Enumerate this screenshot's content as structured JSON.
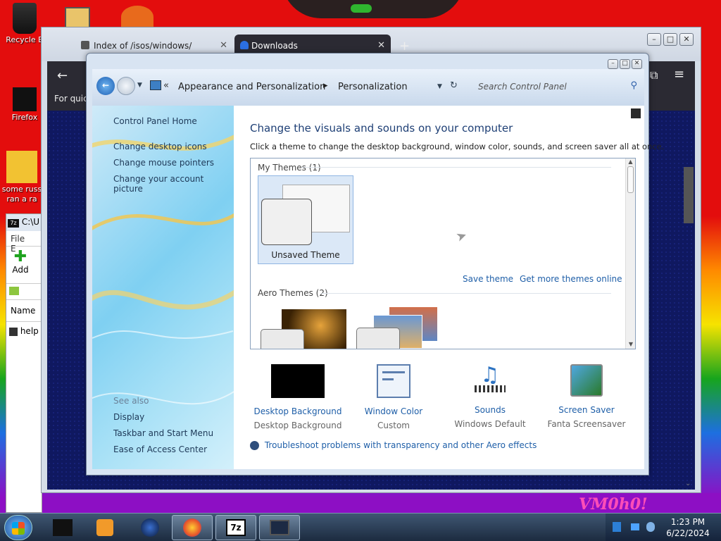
{
  "desktop": {
    "icons": [
      {
        "name": "recycle-bin",
        "label": "Recycle B"
      },
      {
        "name": "firefox",
        "label": "Firefox"
      },
      {
        "name": "some-russian-file",
        "label": "some russ\nran a ra"
      }
    ],
    "vm_label": "VM0h0!"
  },
  "browser": {
    "tabs": [
      {
        "label": "Index of /isos/windows/"
      },
      {
        "label": "Downloads"
      }
    ],
    "toolbar_text": "For quick"
  },
  "sevenzip": {
    "title": "C:\\U",
    "menu": [
      "File",
      "E"
    ],
    "add_label": "Add",
    "column_name": "Name",
    "file": "help"
  },
  "control_panel": {
    "breadcrumb": [
      "Appearance and Personalization",
      "Personalization"
    ],
    "search_placeholder": "Search Control Panel",
    "left_links": [
      "Control Panel Home",
      "Change desktop icons",
      "Change mouse pointers",
      "Change your account picture"
    ],
    "see_also_heading": "See also",
    "see_also_links": [
      "Display",
      "Taskbar and Start Menu",
      "Ease of Access Center"
    ],
    "heading": "Change the visuals and sounds on your computer",
    "description": "Click a theme to change the desktop background, window color, sounds, and screen saver all at once.",
    "my_themes_heading": "My Themes (1)",
    "unsaved_theme_label": "Unsaved Theme",
    "save_theme": "Save theme",
    "get_more_themes": "Get more themes online",
    "aero_themes_heading": "Aero Themes (2)",
    "bottom_items": [
      {
        "label": "Desktop Background",
        "sub": "Desktop Background"
      },
      {
        "label": "Window Color",
        "sub": "Custom"
      },
      {
        "label": "Sounds",
        "sub": "Windows Default"
      },
      {
        "label": "Screen Saver",
        "sub": "Fanta Screensaver"
      }
    ],
    "troubleshoot": "Troubleshoot problems with transparency and other Aero effects"
  },
  "taskbar": {
    "time": "1:23 PM",
    "date": "6/22/2024"
  }
}
